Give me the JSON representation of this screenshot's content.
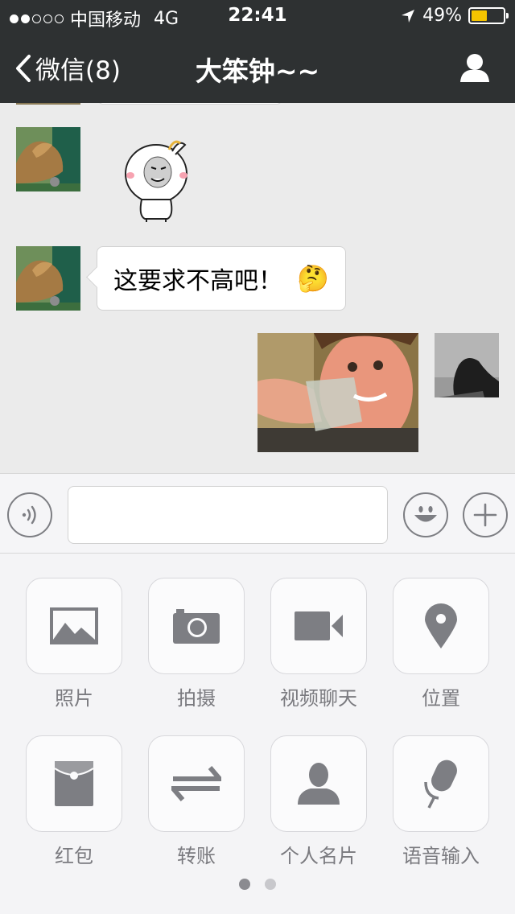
{
  "status_bar": {
    "carrier": "中国移动",
    "network": "4G",
    "time": "22:41",
    "battery": "49%",
    "battery_level": 0.49,
    "signal_bars_filled": 2,
    "signal_bars_total": 5,
    "battery_color": "#f5c400"
  },
  "nav": {
    "back_label": "微信(8)",
    "title": "大笨钟~~",
    "profile_icon": "person-icon"
  },
  "chat": {
    "messages": [
      {
        "type": "sticker",
        "from": "other"
      },
      {
        "type": "text",
        "from": "other",
        "text": "这要求不高吧！",
        "emoji": "🤔"
      },
      {
        "type": "image",
        "from": "self"
      }
    ]
  },
  "input_bar": {
    "voice_icon": "voice-icon",
    "emoji_icon": "smiley-icon",
    "plus_icon": "plus-icon",
    "text": ""
  },
  "panel": {
    "items": [
      {
        "label": "照片",
        "icon": "photo-icon"
      },
      {
        "label": "拍摄",
        "icon": "camera-icon"
      },
      {
        "label": "视频聊天",
        "icon": "video-icon"
      },
      {
        "label": "位置",
        "icon": "location-icon"
      },
      {
        "label": "红包",
        "icon": "red-packet-icon"
      },
      {
        "label": "转账",
        "icon": "transfer-icon"
      },
      {
        "label": "个人名片",
        "icon": "contact-card-icon"
      },
      {
        "label": "语音输入",
        "icon": "microphone-icon"
      }
    ],
    "page_count": 2,
    "current_page": 1
  },
  "colors": {
    "nav_background": "#2e3132",
    "chat_background": "#ebebeb",
    "icon_gray": "#7d7e83"
  }
}
